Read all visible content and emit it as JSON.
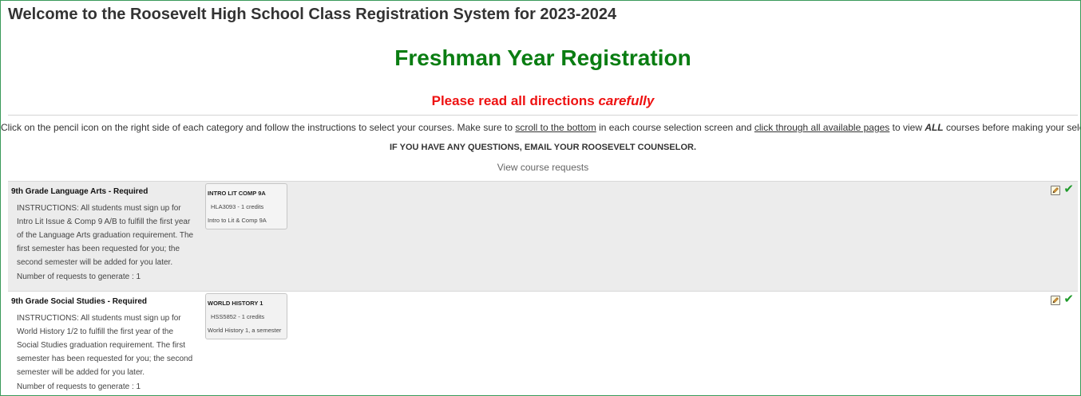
{
  "header": {
    "welcome": "Welcome to the Roosevelt High School Class Registration System for 2023-2024",
    "title": "Freshman Year Registration",
    "read_prefix": "Please read all directions ",
    "read_emphasis": "carefully"
  },
  "directions": {
    "part1": "Click on the pencil icon on the right side of each category and follow the instructions to select your courses. Make sure to ",
    "link1": "scroll to the bottom",
    "part2": " in each course selection screen and ",
    "link2": "click through all available pages",
    "part3": " to view ",
    "emphasis": "ALL",
    "part4": " courses before making your selection.",
    "questions": "IF YOU HAVE ANY QUESTIONS, EMAIL YOUR ROOSEVELT COUNSELOR.",
    "view_requests": "View course requests"
  },
  "categories": [
    {
      "title": "9th Grade Language Arts - Required",
      "instructions": "INSTRUCTIONS: All students must sign up for Intro Lit Issue & Comp 9 A/B to fulfill the first year of the Language Arts graduation requirement. The first semester has been requested for you; the second semester will be added for you later.",
      "count": "Number of requests to generate : 1",
      "course": {
        "code": "INTRO LIT COMP 9A",
        "credits": "HLA3093 - 1 credits",
        "name": "Intro to Lit & Comp 9A"
      },
      "edit_icon": "pencil-edit-icon",
      "status_icon": "check-icon",
      "status_color": "#1e9a2a"
    },
    {
      "title": "9th Grade Social Studies - Required",
      "instructions": "INSTRUCTIONS: All students must sign up for World History 1/2 to fulfill the first year of the Social Studies graduation requirement. The first semester has been requested for you; the second semester will be added for you later.",
      "count": "Number of requests to generate : 1",
      "course": {
        "code": "WORLD HISTORY 1",
        "credits": "HSS5852 - 1 credits",
        "name": "World History 1, a semester"
      },
      "edit_icon": "pencil-edit-icon",
      "status_icon": "check-icon",
      "status_color": "#1e9a2a"
    }
  ],
  "colors": {
    "title_green": "#0a7d12",
    "warning_red": "#ee1111",
    "row_alt": "#ececec",
    "frame_border": "#3a9a5a"
  }
}
